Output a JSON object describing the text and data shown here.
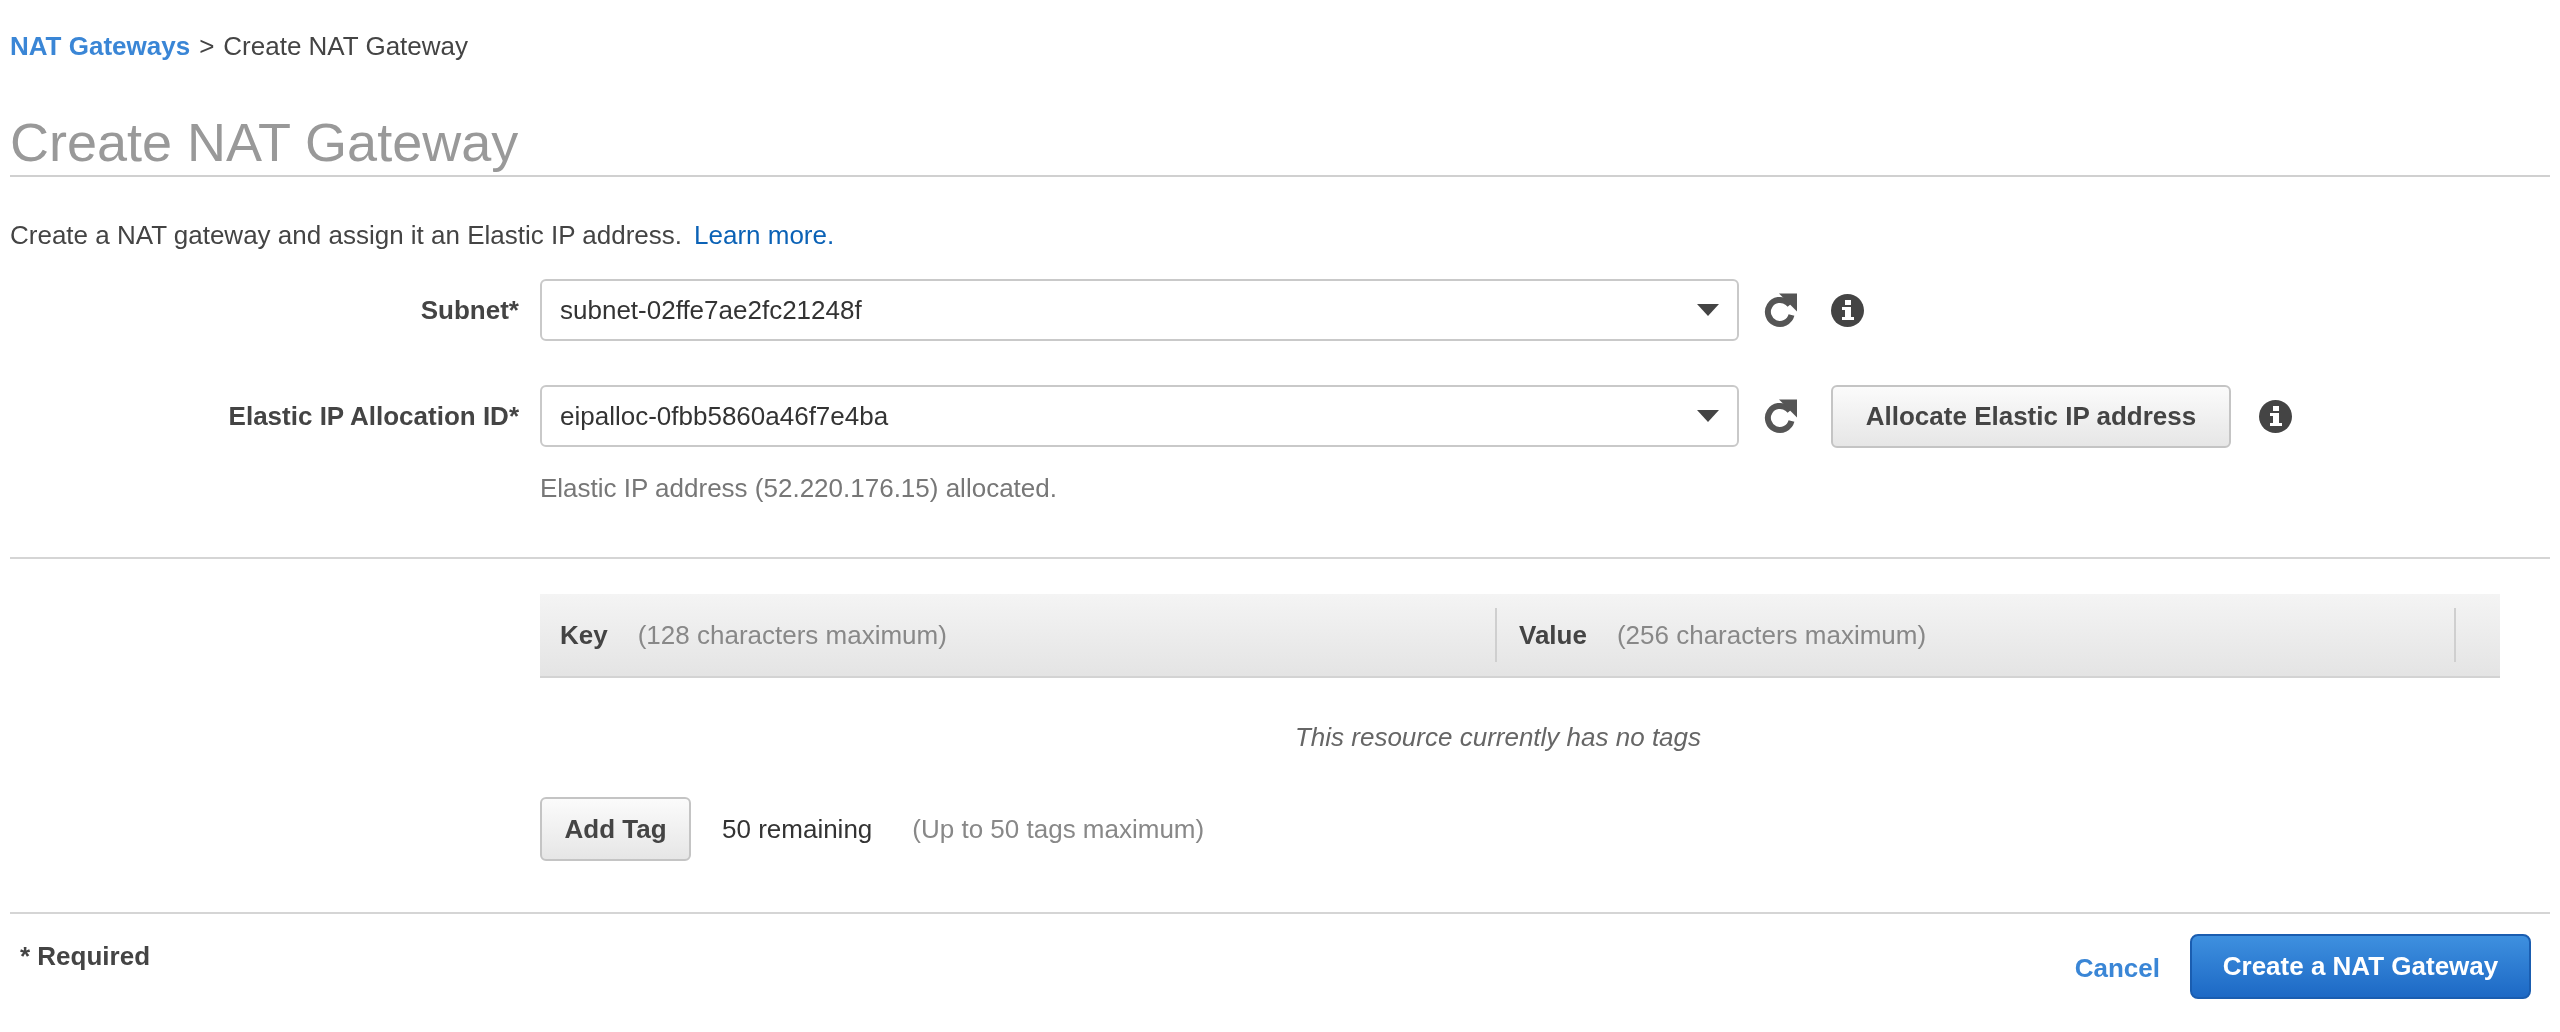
{
  "breadcrumb": {
    "link": "NAT Gateways",
    "separator": ">",
    "current": "Create NAT Gateway"
  },
  "page_title": "Create NAT Gateway",
  "intro": {
    "text": "Create a NAT gateway and assign it an Elastic IP address.",
    "link": "Learn more."
  },
  "form": {
    "fields": [
      {
        "label": "Subnet*",
        "value": "subnet-02ffe7ae2fc21248f"
      },
      {
        "label": "Elastic IP Allocation ID*",
        "value": "eipalloc-0fbb5860a46f7e4ba",
        "action": "Allocate Elastic IP address",
        "hint": "Elastic IP address (52.220.176.15) allocated."
      }
    ]
  },
  "tags": {
    "columns": [
      {
        "name": "Key",
        "hint": "(128 characters maximum)"
      },
      {
        "name": "Value",
        "hint": "(256 characters maximum)"
      }
    ],
    "empty_message": "This resource currently has no tags",
    "add_button": "Add Tag",
    "remaining": "50 remaining",
    "limit_note": "(Up to 50 tags maximum)"
  },
  "footer": {
    "required_note": "* Required",
    "cancel": "Cancel",
    "submit": "Create a NAT Gateway"
  }
}
